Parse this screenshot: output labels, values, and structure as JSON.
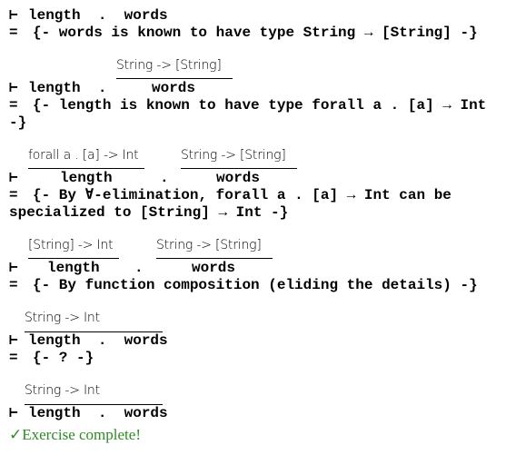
{
  "turnstile": "⊢",
  "eq": "=",
  "steps": [
    {
      "line": "length  .  words",
      "comment": "{- words is known to have type String → [String] -}"
    },
    {
      "line": "length  .",
      "term2": "words",
      "type2": "String -> [String]",
      "comment": "{- length is known to have type forall a . [a] → Int -}"
    },
    {
      "term1": "length",
      "type1": "forall a . [a] -> Int",
      "dot": ".",
      "term2": "words",
      "type2": "String -> [String]",
      "comment": "{- By ∀-elimination, forall a . [a] → Int can be specialized to [String] → Int -}"
    },
    {
      "term1": "length",
      "type1": "[String] -> Int",
      "dot": ".",
      "term2": "words",
      "type2": "String -> [String]",
      "comment": "{- By function composition (eliding the details) -}"
    },
    {
      "line": "length  .  words",
      "type": "String -> Int",
      "comment": "{- ? -}"
    },
    {
      "line": "length  .  words",
      "type": "String -> Int"
    }
  ],
  "status": {
    "text": "✓Exercise complete!",
    "color": "#2e8b24"
  }
}
